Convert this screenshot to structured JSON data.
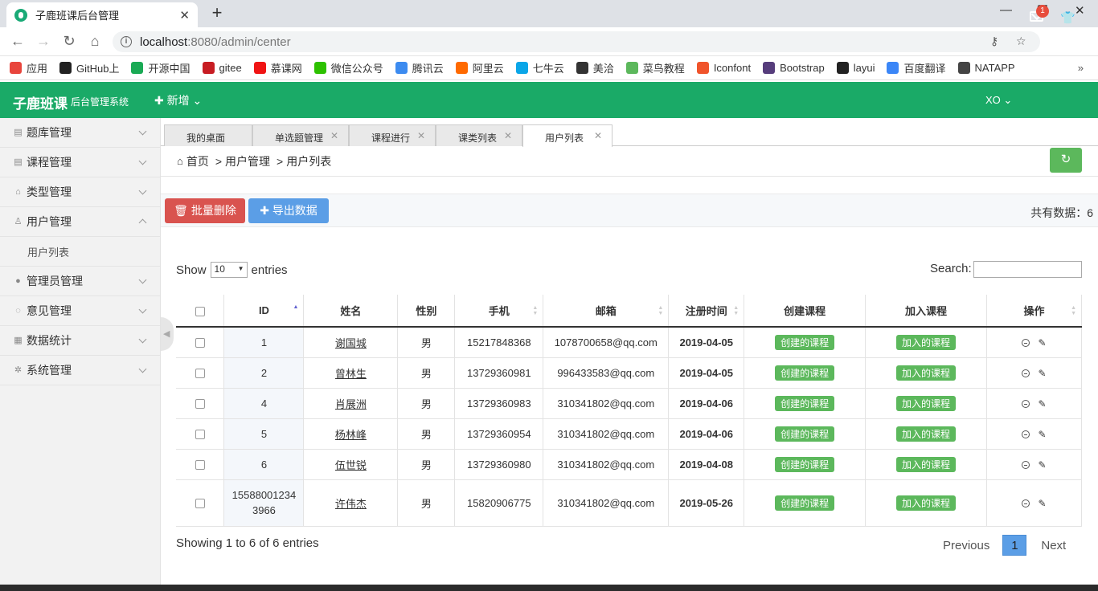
{
  "browser": {
    "tab_title": "子鹿班课后台管理",
    "tab_close": "✕",
    "new_tab": "+",
    "url_host": "localhost",
    "url_rest": ":8080/admin/center",
    "win_min": "—",
    "win_max": "❐",
    "win_close": "✕",
    "bookmarks": [
      {
        "label": "应用",
        "color": "#e8453c"
      },
      {
        "label": "GitHub上",
        "color": "#222222"
      },
      {
        "label": "开源中国",
        "color": "#1aaa55"
      },
      {
        "label": "gitee",
        "color": "#c71d23"
      },
      {
        "label": "慕课网",
        "color": "#f01414"
      },
      {
        "label": "微信公众号",
        "color": "#2dc100"
      },
      {
        "label": "腾讯云",
        "color": "#3c8bf0"
      },
      {
        "label": "阿里云",
        "color": "#ff6a00"
      },
      {
        "label": "七牛云",
        "color": "#0aa6e8"
      },
      {
        "label": "美洽",
        "color": "#333333"
      },
      {
        "label": "菜鸟教程",
        "color": "#5cb85c"
      },
      {
        "label": "Iconfont",
        "color": "#f0542b"
      },
      {
        "label": "Bootstrap",
        "color": "#563d7c"
      },
      {
        "label": "layui",
        "color": "#222222"
      },
      {
        "label": "百度翻译",
        "color": "#3b86f7"
      },
      {
        "label": "NATAPP",
        "color": "#444444"
      }
    ],
    "bookmarks_more": "»"
  },
  "header": {
    "logo": "子鹿班课",
    "subtitle": "后台管理系统",
    "add_new": "✚ 新增 ⌄",
    "user": "XO ⌄",
    "mail_badge": "1",
    "accent": "#1aaa67"
  },
  "sidebar": {
    "items": [
      {
        "label": "题库管理",
        "icon": "▤"
      },
      {
        "label": "课程管理",
        "icon": "▤"
      },
      {
        "label": "类型管理",
        "icon": "⌂"
      },
      {
        "label": "用户管理",
        "icon": "♙"
      },
      {
        "label": "管理员管理",
        "icon": "●"
      },
      {
        "label": "意见管理",
        "icon": "◌"
      },
      {
        "label": "数据统计",
        "icon": "▦"
      },
      {
        "label": "系统管理",
        "icon": "✲"
      }
    ],
    "sub_item": "用户列表"
  },
  "page_tabs": [
    "我的桌面",
    "单选题管理",
    "课程进行",
    "课类列表",
    "用户列表"
  ],
  "breadcrumb": [
    "首页",
    "用户管理",
    "用户列表"
  ],
  "toolbar": {
    "delete_label": "批量删除",
    "export_label": "导出数据",
    "total_label": "共有数据：6"
  },
  "table_controls": {
    "show_prefix": "Show",
    "page_size": "10",
    "show_suffix": "entries",
    "search_label": "Search:"
  },
  "table": {
    "headers": [
      "ID",
      "姓名",
      "性别",
      "手机",
      "邮箱",
      "注册时间",
      "创建课程",
      "加入课程",
      "操作"
    ],
    "create_label": "创建的课程",
    "join_label": "加入的课程",
    "rows": [
      {
        "id": "1",
        "name": "谢国城",
        "gender": "男",
        "phone": "15217848368",
        "email": "1078700658@qq.com",
        "date": "2019-04-05"
      },
      {
        "id": "2",
        "name": "曾林生",
        "gender": "男",
        "phone": "13729360981",
        "email": "996433583@qq.com",
        "date": "2019-04-05"
      },
      {
        "id": "4",
        "name": "肖展洲",
        "gender": "男",
        "phone": "13729360983",
        "email": "310341802@qq.com",
        "date": "2019-04-06"
      },
      {
        "id": "5",
        "name": "杨林峰",
        "gender": "男",
        "phone": "13729360954",
        "email": "310341802@qq.com",
        "date": "2019-04-06"
      },
      {
        "id": "6",
        "name": "伍世锐",
        "gender": "男",
        "phone": "13729360980",
        "email": "310341802@qq.com",
        "date": "2019-04-08"
      },
      {
        "id_line1": "15588001234",
        "id_line2": "3966",
        "name": "许伟杰",
        "gender": "男",
        "phone": "15820906775",
        "email": "310341802@qq.com",
        "date": "2019-05-26"
      }
    ]
  },
  "pagination": {
    "info": "Showing 1 to 6 of 6 entries",
    "previous": "Previous",
    "page": "1",
    "next": "Next"
  }
}
